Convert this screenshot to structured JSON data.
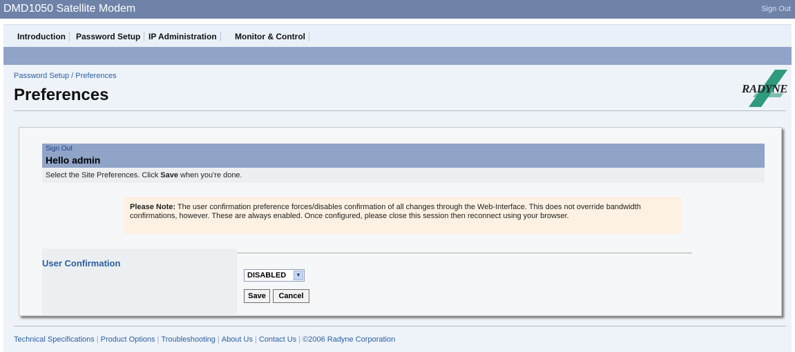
{
  "header": {
    "app_title": "DMD1050 Satellite Modem",
    "signout": "Sign Out"
  },
  "nav": {
    "tabs": [
      "Introduction",
      "Password Setup",
      "IP Administration",
      "Monitor & Control"
    ]
  },
  "page": {
    "breadcrumb": "Password Setup / Preferences",
    "title": "Preferences",
    "logo_text": "RADYNE"
  },
  "panel": {
    "signout": "Sign Out",
    "hello": "Hello admin",
    "instruction_pre": "Select the Site Preferences. Click ",
    "instruction_bold": "Save",
    "instruction_post": " when you're done.",
    "note_label": "Please Note:",
    "note_text": " The user confirmation preference forces/disables confirmation of all changes through the Web-Interface. This does not override bandwidth confirmations, however. These are always enabled. Once configured, please close this session then reconnect using your browser.",
    "field_label": "User Confirmation",
    "select_value": "DISABLED",
    "save_label": "Save",
    "cancel_label": "Cancel"
  },
  "footer": {
    "links": [
      "Technical Specifications",
      "Product Options",
      "Troubleshooting",
      "About Us",
      "Contact Us"
    ],
    "copyright": "©2006 Radyne Corporation"
  },
  "colors": {
    "titlebar": "#6f82a8",
    "navbar": "#eaf0f8",
    "bluebar": "#90a4c8",
    "link": "#2b5e9e",
    "note_bg": "#fcf1e2"
  }
}
